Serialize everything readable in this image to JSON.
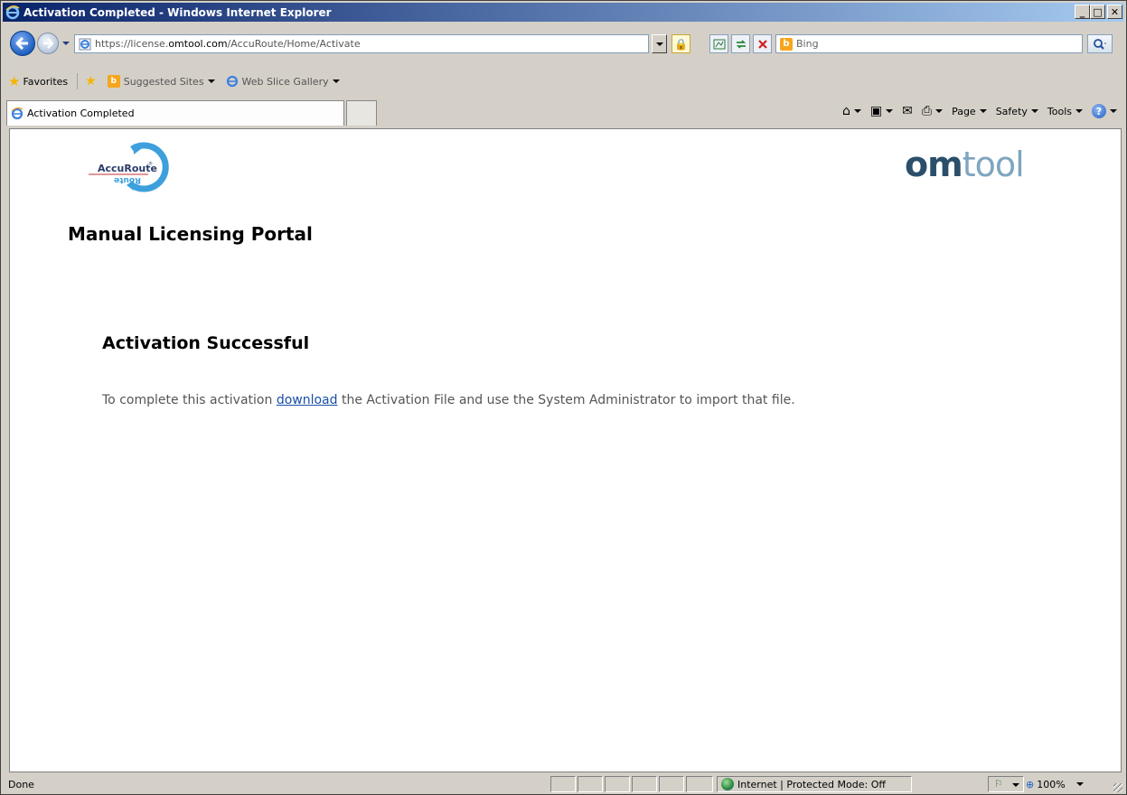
{
  "window": {
    "title": "Activation Completed - Windows Internet Explorer",
    "min_label": "_",
    "max_label": "□",
    "close_label": "✕"
  },
  "address": {
    "url_prefix": "https://license.",
    "url_host": "omtool.com",
    "url_path": "/AccuRoute/Home/Activate"
  },
  "search": {
    "placeholder": "Bing"
  },
  "favorites": {
    "label": "Favorites",
    "links": [
      {
        "label": "Suggested Sites"
      },
      {
        "label": "Web Slice Gallery"
      }
    ]
  },
  "tabs": [
    {
      "label": "Activation Completed"
    }
  ],
  "commandbar": {
    "page": "Page",
    "safety": "Safety",
    "tools": "Tools"
  },
  "page": {
    "brand_accuroute_top": "AccuRoute",
    "brand_accuroute_bottom": "Route",
    "brand_omtool_om": "om",
    "brand_omtool_tool": "tool",
    "portal_title": "Manual Licensing Portal",
    "activation_title": "Activation Successful",
    "message_before": "To complete this activation ",
    "message_link": "download",
    "message_after": " the Activation File and use the System Administrator to import that file."
  },
  "status": {
    "text": "Done",
    "zone": "Internet | Protected Mode: Off",
    "zoom": "100%"
  },
  "colors": {
    "titlebar_start": "#0a246a",
    "titlebar_end": "#a6caf0",
    "link": "#1a4ea8",
    "omtool_dark": "#2b4f6a",
    "omtool_light": "#7fa5c0"
  }
}
